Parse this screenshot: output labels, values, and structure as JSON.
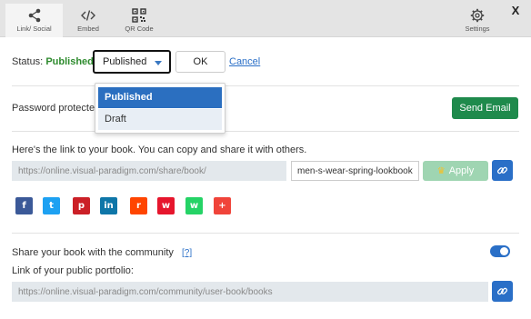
{
  "tabs": [
    {
      "label": "Link/ Social",
      "icon": "share-icon",
      "active": true
    },
    {
      "label": "Embed",
      "icon": "code-icon",
      "active": false
    },
    {
      "label": "QR Code",
      "icon": "qr-code-icon",
      "active": false
    }
  ],
  "settings": {
    "label": "Settings",
    "icon": "gear-icon"
  },
  "close_label": "X",
  "status": {
    "label": "Status:",
    "value": "Published",
    "select_value": "Published",
    "ok_label": "OK",
    "cancel_label": "Cancel",
    "options": [
      "Published",
      "Draft"
    ]
  },
  "password": {
    "label": "Password protected",
    "send_email_label": "Send Email"
  },
  "link": {
    "description": "Here's the link to your book. You can copy and share it with others.",
    "base_url": "https://online.visual-paradigm.com/share/book/",
    "slug": "men-s-wear-spring-lookbook",
    "apply_label": "Apply"
  },
  "social": [
    {
      "name": "facebook",
      "glyph": "f",
      "color": "#3b5998"
    },
    {
      "name": "twitter",
      "glyph": "t",
      "color": "#1da1f2"
    },
    {
      "name": "pinterest",
      "glyph": "p",
      "color": "#cb2027"
    },
    {
      "name": "linkedin",
      "glyph": "in",
      "color": "#0e76a8"
    },
    {
      "name": "reddit",
      "glyph": "r",
      "color": "#ff4500"
    },
    {
      "name": "weibo",
      "glyph": "w",
      "color": "#e6162d"
    },
    {
      "name": "whatsapp",
      "glyph": "w",
      "color": "#25d366"
    },
    {
      "name": "more",
      "glyph": "+",
      "color": "#f0443a"
    }
  ],
  "community": {
    "label": "Share your book with the community",
    "help_label": "[?]",
    "toggle_on": true,
    "portfolio_label": "Link of your public portfolio:",
    "portfolio_url": "https://online.visual-paradigm.com/community/user-book/books"
  },
  "colors": {
    "accent": "#2a6fc7",
    "published": "#2e8b2e",
    "send_email": "#1f8a4c",
    "apply_disabled": "#9fd5b2"
  }
}
